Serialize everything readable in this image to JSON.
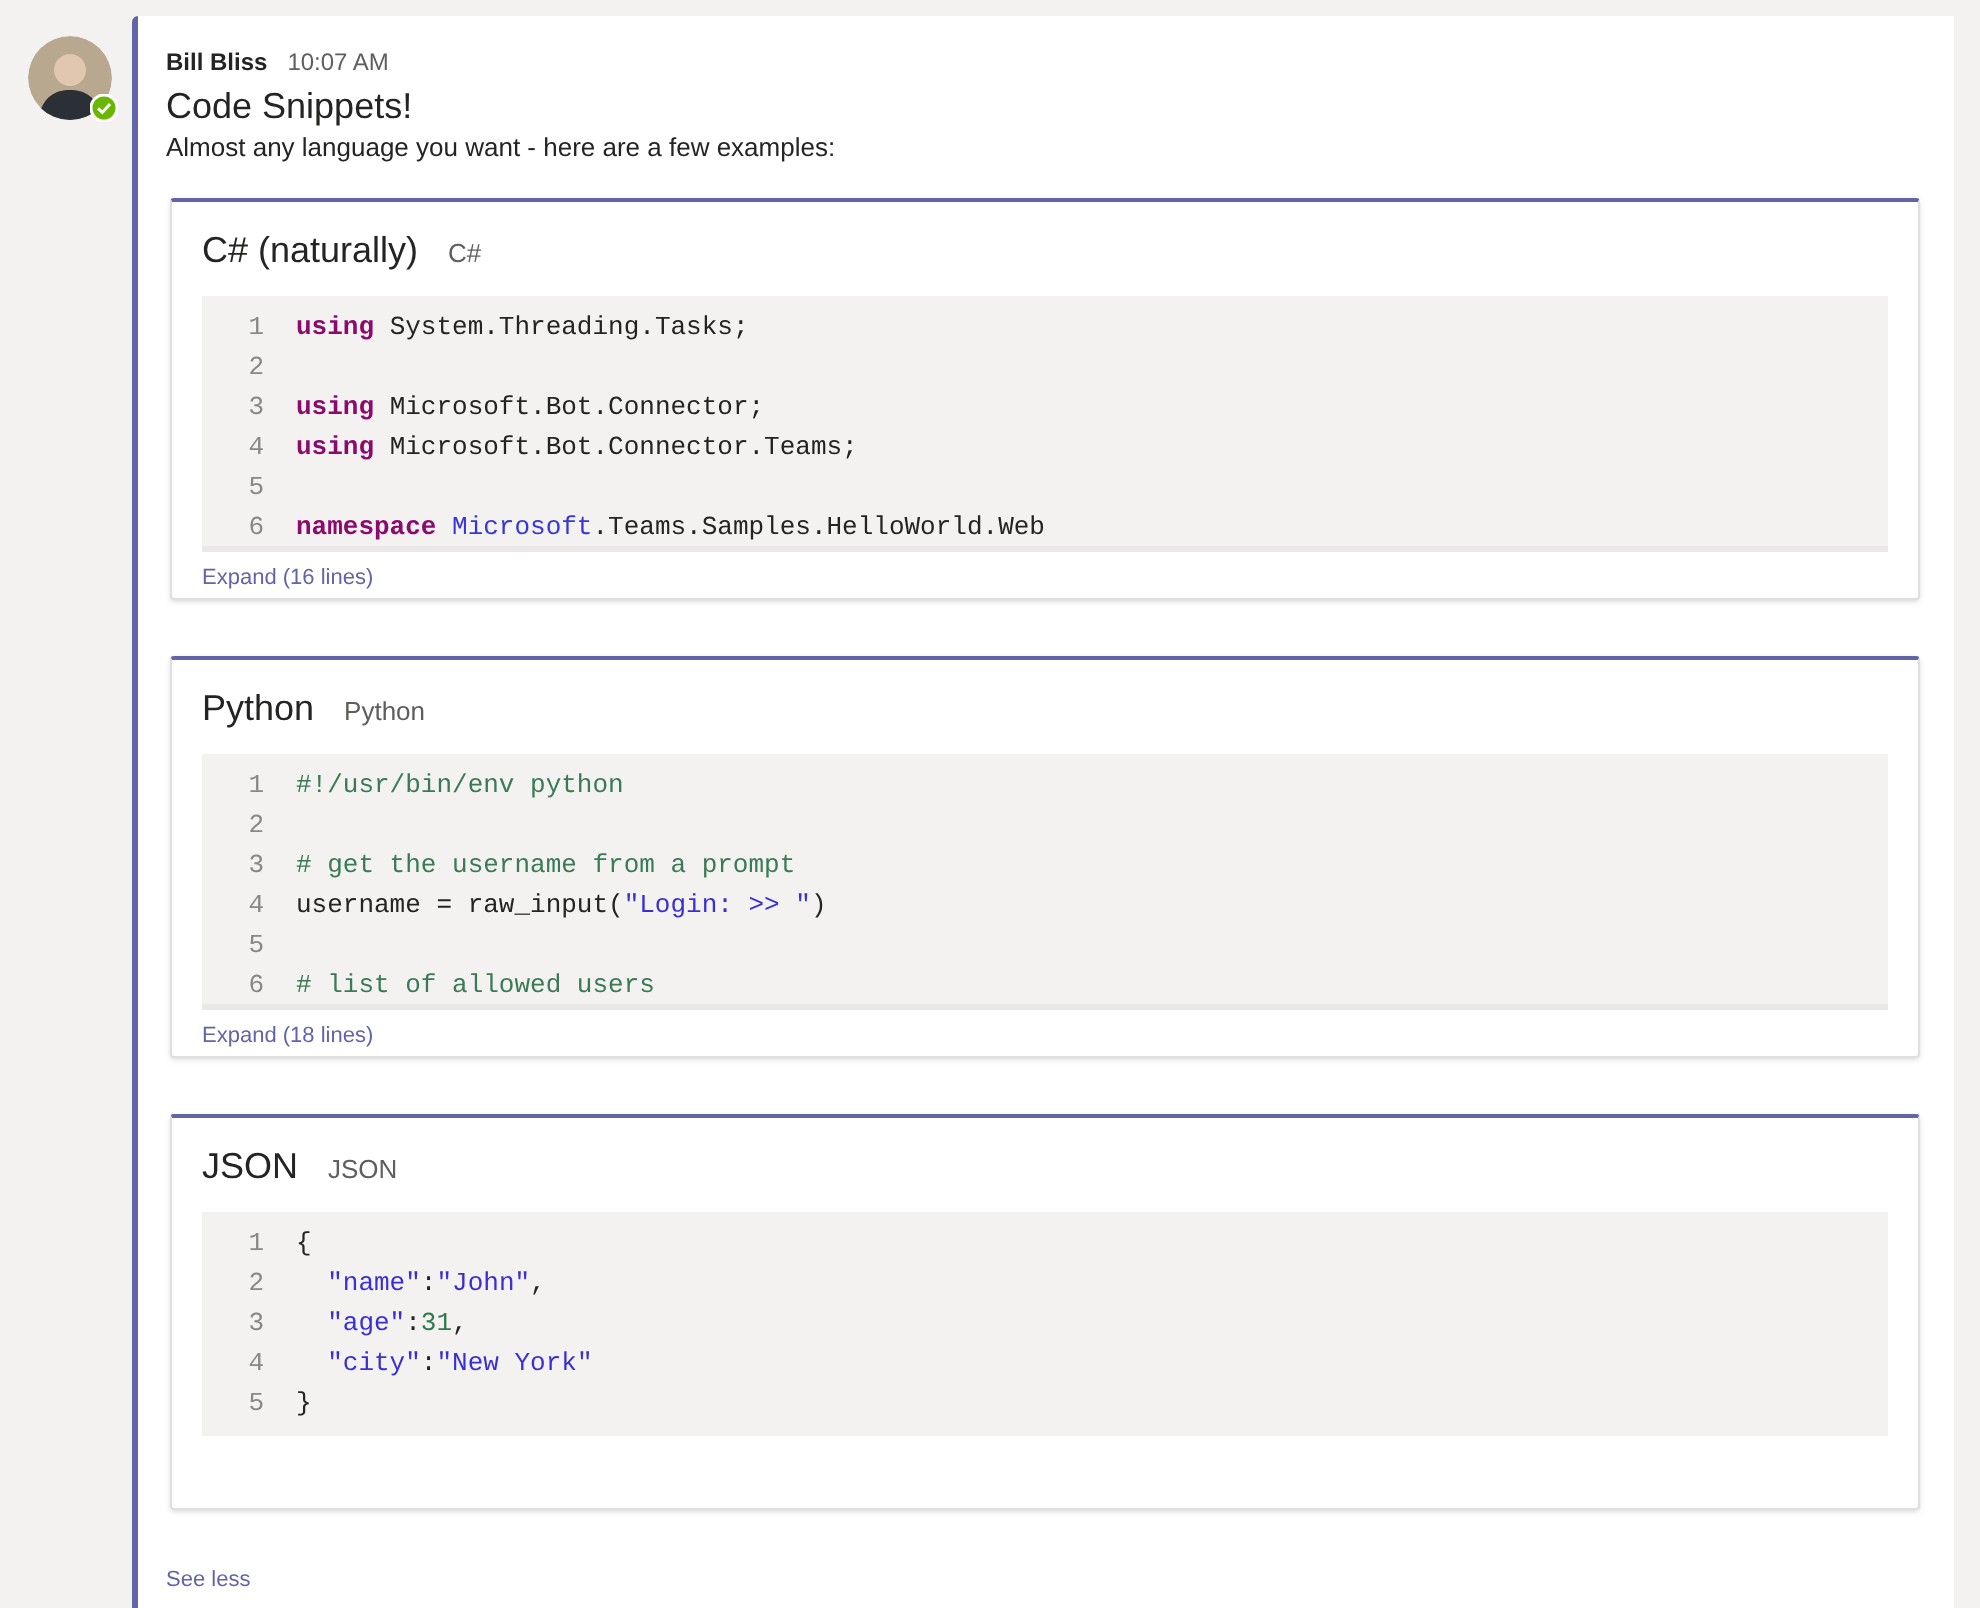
{
  "message": {
    "author": "Bill Bliss",
    "time": "10:07 AM",
    "title": "Code Snippets!",
    "text": "Almost any language you want - here are a few examples:",
    "snippets": [
      {
        "title": "C# (naturally)",
        "language": "C#",
        "expand": "Expand (16 lines)",
        "lines": [
          {
            "number": "1",
            "tokens": [
              {
                "kind": "keyword",
                "text": "using"
              },
              {
                "kind": "plain",
                "text": " System.Threading.Tasks;"
              }
            ]
          },
          {
            "number": "2"
          },
          {
            "number": "3",
            "tokens": [
              {
                "kind": "keyword",
                "text": "using"
              },
              {
                "kind": "plain",
                "text": " Microsoft.Bot.Connector;"
              }
            ]
          },
          {
            "number": "4",
            "tokens": [
              {
                "kind": "keyword",
                "text": "using"
              },
              {
                "kind": "plain",
                "text": " Microsoft.Bot.Connector.Teams;"
              }
            ]
          },
          {
            "number": "5"
          },
          {
            "number": "6",
            "tokens": [
              {
                "kind": "keyword",
                "text": "namespace"
              },
              {
                "kind": "type",
                "text": " Microsoft"
              },
              {
                "kind": "plain",
                "text": ".Teams.Samples.HelloWorld.Web"
              }
            ]
          }
        ]
      },
      {
        "title": "Python",
        "language": "Python",
        "expand": "Expand (18 lines)",
        "lines": [
          {
            "number": "1",
            "tokens": [
              {
                "kind": "comment",
                "text": "#!/usr/bin/env python"
              }
            ]
          },
          {
            "number": "2"
          },
          {
            "number": "3",
            "tokens": [
              {
                "kind": "comment",
                "text": "# get the username from a prompt"
              }
            ]
          },
          {
            "number": "4",
            "tokens": [
              {
                "kind": "plain",
                "text": "username = raw_input("
              },
              {
                "kind": "string",
                "text": "\"Login: >> \""
              },
              {
                "kind": "plain",
                "text": ")"
              }
            ]
          },
          {
            "number": "5"
          },
          {
            "number": "6",
            "tokens": [
              {
                "kind": "comment",
                "text": "# list of allowed users"
              }
            ]
          }
        ]
      },
      {
        "title": "JSON",
        "language": "JSON",
        "lines": [
          {
            "number": "1",
            "tokens": [
              {
                "kind": "plain",
                "text": "{"
              }
            ]
          },
          {
            "number": "2",
            "tokens": [
              {
                "kind": "string",
                "text": "  \"name\""
              },
              {
                "kind": "plain",
                "text": ":"
              },
              {
                "kind": "string",
                "text": "\"John\""
              },
              {
                "kind": "plain",
                "text": ","
              }
            ]
          },
          {
            "number": "3",
            "tokens": [
              {
                "kind": "string",
                "text": "  \"age\""
              },
              {
                "kind": "plain",
                "text": ":"
              },
              {
                "kind": "number",
                "text": "31"
              },
              {
                "kind": "plain",
                "text": ","
              }
            ]
          },
          {
            "number": "4",
            "tokens": [
              {
                "kind": "string",
                "text": "  \"city\""
              },
              {
                "kind": "plain",
                "text": ":"
              },
              {
                "kind": "string",
                "text": "\"New York\""
              }
            ]
          },
          {
            "number": "5",
            "tokens": [
              {
                "kind": "plain",
                "text": "}"
              }
            ]
          }
        ]
      }
    ],
    "see_less": "See less"
  }
}
